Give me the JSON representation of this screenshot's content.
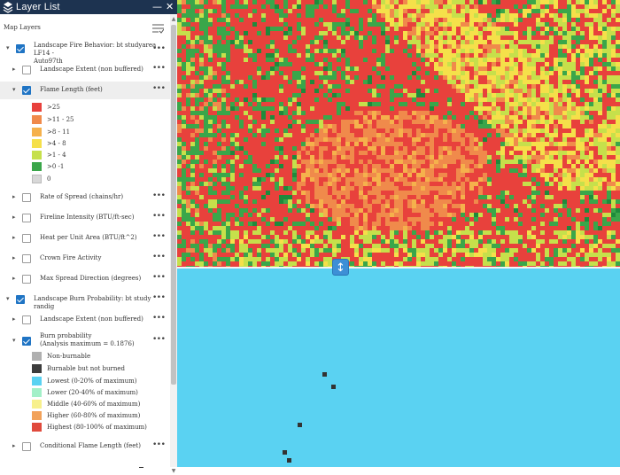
{
  "panel": {
    "title": "Layer List",
    "minimize_symbol": "—",
    "close_symbol": "✕",
    "subheader": "Map Layers",
    "layers": [
      {
        "label_lines": [
          "Landscape Fire Behavior: bt studyarea LF14 -",
          "Auto97th"
        ],
        "checked": true,
        "expanded": true,
        "level": 0
      },
      {
        "label_lines": [
          "Landscape Extent (non buffered)"
        ],
        "checked": false,
        "expanded": false,
        "level": 1
      },
      {
        "label_lines": [
          "Flame Length (feet)"
        ],
        "checked": true,
        "expanded": true,
        "level": 1,
        "highlighted": true
      },
      {
        "label_lines": [
          "Rate of Spread (chains/hr)"
        ],
        "checked": false,
        "expanded": false,
        "level": 1
      },
      {
        "label_lines": [
          "Fireline Intensity (BTU/ft-sec)"
        ],
        "checked": false,
        "expanded": false,
        "level": 1
      },
      {
        "label_lines": [
          "Heat per Unit Area (BTU/ft^2)"
        ],
        "checked": false,
        "expanded": false,
        "level": 1
      },
      {
        "label_lines": [
          "Crown Fire Activity"
        ],
        "checked": false,
        "expanded": false,
        "level": 1
      },
      {
        "label_lines": [
          "Max Spread Direction (degrees)"
        ],
        "checked": false,
        "expanded": false,
        "level": 1
      },
      {
        "label_lines": [
          "Landscape Burn Probability: bt study randig"
        ],
        "checked": true,
        "expanded": true,
        "level": 0
      },
      {
        "label_lines": [
          "Landscape Extent (non buffered)"
        ],
        "checked": false,
        "expanded": false,
        "level": 1
      },
      {
        "label_lines": [
          "Burn probability",
          "(Analysis maximum = 0.1876)"
        ],
        "checked": true,
        "expanded": true,
        "level": 1
      },
      {
        "label_lines": [
          "Conditional Flame Length (feet)"
        ],
        "checked": false,
        "expanded": false,
        "level": 1
      }
    ],
    "flame_legend": [
      {
        "label": ">25",
        "color": "#e8413c"
      },
      {
        "label": ">11 - 25",
        "color": "#f08a4b"
      },
      {
        "label": ">8 - 11",
        "color": "#f5b14c"
      },
      {
        "label": ">4 - 8",
        "color": "#f5e04a"
      },
      {
        "label": ">1 - 4",
        "color": "#c6e04b"
      },
      {
        "label": ">0 -1",
        "color": "#3aa64a"
      },
      {
        "label": "0",
        "color": "#d8d8d8"
      }
    ],
    "burn_legend": [
      {
        "label": "Non-burnable",
        "color": "#b0b0b0"
      },
      {
        "label": "Burnable but not burned",
        "color": "#3c3c3c"
      },
      {
        "label": "Lowest (0-20% of maximum)",
        "color": "#5ad2f2"
      },
      {
        "label": "Lower (20-40% of maximum)",
        "color": "#a3f0c8"
      },
      {
        "label": "Middle (40-60% of maximum)",
        "color": "#f7f08c"
      },
      {
        "label": "Higher (60-80% of maximum)",
        "color": "#f2a25a"
      },
      {
        "label": "Highest (80-100% of maximum)",
        "color": "#e04a3c"
      }
    ]
  },
  "map": {
    "swipe_symbol": "↕",
    "lower_color": "#5ad2f2"
  }
}
